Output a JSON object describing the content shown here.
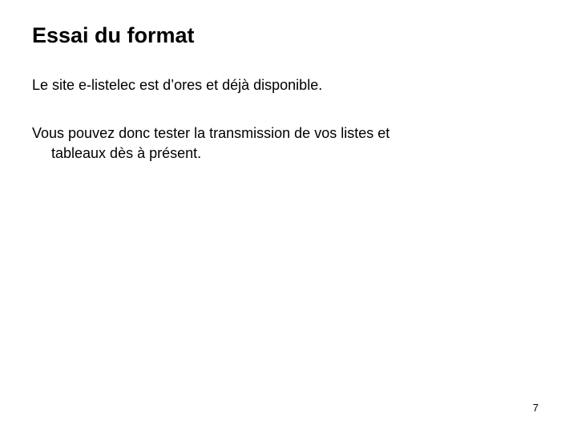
{
  "slide": {
    "title": "Essai du format",
    "paragraph1": "Le site e-listelec est d’ores et déjà disponible.",
    "paragraph2_line1": "Vous pouvez donc tester la transmission de vos listes et",
    "paragraph2_line2": "tableaux dès à présent.",
    "page_number": "7"
  }
}
